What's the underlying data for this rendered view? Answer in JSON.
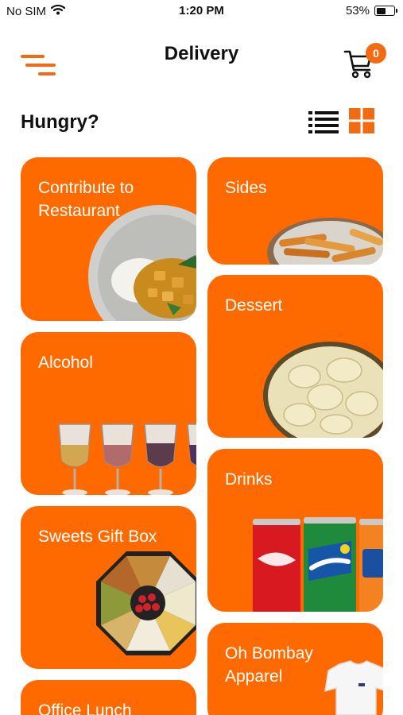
{
  "status_bar": {
    "carrier": "No SIM",
    "time": "1:20 PM",
    "battery": "53%",
    "battery_level": 0.53
  },
  "header": {
    "title": "Delivery",
    "cart_count": "0",
    "menu_icon": "menu-icon",
    "cart_icon": "cart-icon"
  },
  "section": {
    "title": "Hungry?",
    "list_view_icon": "list-view-icon",
    "grid_view_icon": "grid-view-icon",
    "active_view": "grid"
  },
  "colors": {
    "accent": "#ff6a00",
    "menu_accent": "#f26a12"
  },
  "categories": [
    {
      "label": "Contribute to Restaurant",
      "image": "curry-plate-image"
    },
    {
      "label": "Sides",
      "image": "fries-bowl-image"
    },
    {
      "label": "Dessert",
      "image": "dessert-bowl-image"
    },
    {
      "label": "Alcohol",
      "image": "wine-glasses-image"
    },
    {
      "label": "Drinks",
      "image": "soda-cans-image"
    },
    {
      "label": "Sweets Gift Box",
      "image": "sweets-box-image"
    },
    {
      "label": "Oh Bombay Apparel",
      "image": "tshirt-image"
    },
    {
      "label": "Office Lunch",
      "image": ""
    }
  ]
}
